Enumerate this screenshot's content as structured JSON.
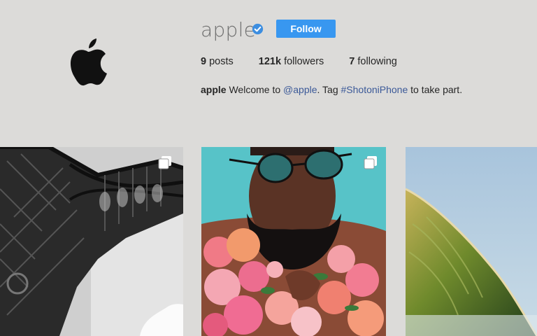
{
  "profile": {
    "username": "apple",
    "follow_label": "Follow",
    "stats": [
      {
        "count": "9",
        "label": "posts"
      },
      {
        "count": "121k",
        "label": "followers"
      },
      {
        "count": "7",
        "label": "following"
      }
    ],
    "bio": {
      "name": "apple",
      "pre": "Welcome to",
      "mention": "@apple",
      "mid": ". Tag",
      "hashtag": "#ShotoniPhone",
      "post": "to take part."
    }
  },
  "colors": {
    "background": "#dcdbd9",
    "follow_button": "#3897f0",
    "verified_badge": "#3d8ee0",
    "link": "#3b5998"
  },
  "icons": {
    "avatar": "apple-logo-icon",
    "verified": "verified-badge-icon",
    "multi_post": "multiple-photos-icon"
  },
  "posts": [
    {
      "subject": "eiffel-tower-photo",
      "multiple": true
    },
    {
      "subject": "man-with-flowers-photo",
      "multiple": true
    },
    {
      "subject": "wave-photo",
      "multiple": false
    }
  ]
}
